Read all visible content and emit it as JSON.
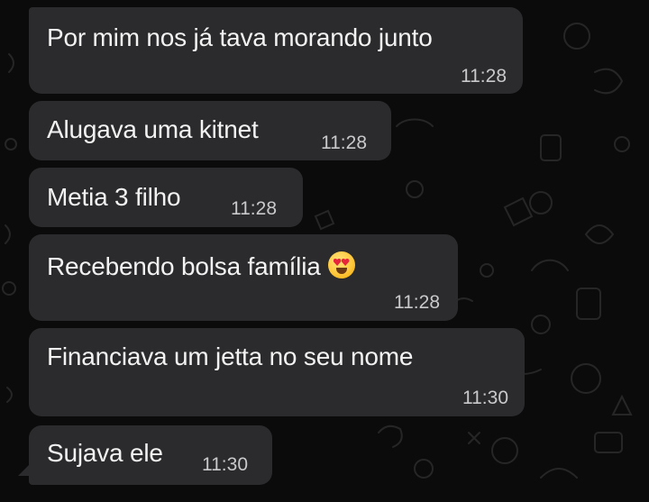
{
  "messages": [
    {
      "text": "Por mim nos já tava morando junto",
      "time": "11:28"
    },
    {
      "text": "Alugava uma kitnet",
      "time": "11:28"
    },
    {
      "text": "Metia 3 filho",
      "time": "11:28"
    },
    {
      "text": "Recebendo bolsa família",
      "time": "11:28",
      "emoji": "heart-eyes-emoji"
    },
    {
      "text": "Financiava um jetta no seu nome",
      "time": "11:30"
    },
    {
      "text": "Sujava ele",
      "time": "11:30"
    }
  ],
  "colors": {
    "background": "#0b0b0b",
    "bubble": "#2b2b2d",
    "text": "#f2f2f2",
    "timestamp": "#c9c9cb"
  }
}
